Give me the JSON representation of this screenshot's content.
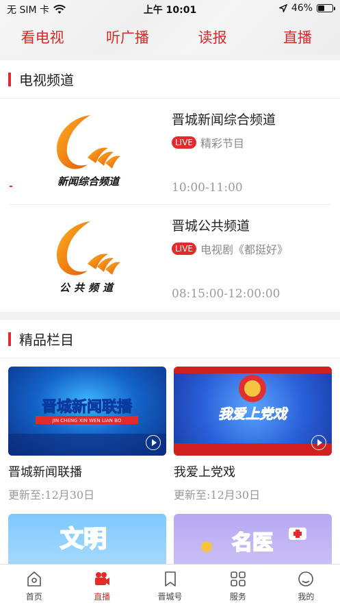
{
  "status_bar": {
    "carrier": "无 SIM 卡",
    "time": "上午 10:01",
    "battery": "46%",
    "battery_level": 0.46
  },
  "top_nav": {
    "tabs": [
      {
        "label": "看电视"
      },
      {
        "label": "听广播"
      },
      {
        "label": "读报"
      },
      {
        "label": "直播"
      }
    ]
  },
  "tv_section": {
    "title": "电视频道",
    "channels": [
      {
        "logo_text": "新闻综合频道",
        "name": "晋城新闻综合频道",
        "badge": "LIVE",
        "program": "精彩节目",
        "time": "10:00-11:00"
      },
      {
        "logo_text": "公共频道",
        "name": "晋城公共频道",
        "badge": "LIVE",
        "program": "电视剧《都挺好》",
        "time": "08:15:00-12:00:00"
      }
    ]
  },
  "featured_section": {
    "title": "精品栏目",
    "cards": [
      {
        "thumb_title": "晋城新闻联播",
        "thumb_sub": "JIN CHENG XIN WEN LIAN BO",
        "title": "晋城新闻联播",
        "date": "更新至:12月30日"
      },
      {
        "thumb_title": "我爱上党戏",
        "title": "我爱上党戏",
        "date": "更新至:12月30日"
      },
      {
        "thumb_title": "文明"
      },
      {
        "thumb_title": "名医"
      }
    ]
  },
  "tab_bar": {
    "items": [
      {
        "label": "首页",
        "icon": "home-icon"
      },
      {
        "label": "直播",
        "icon": "camera-icon"
      },
      {
        "label": "晋城号",
        "icon": "bookmark-icon"
      },
      {
        "label": "服务",
        "icon": "grid-icon"
      },
      {
        "label": "我的",
        "icon": "profile-icon"
      }
    ]
  },
  "colors": {
    "accent": "#e32b2b",
    "nav_text": "#d62b2b",
    "secondary_text": "#9a9a9a"
  }
}
